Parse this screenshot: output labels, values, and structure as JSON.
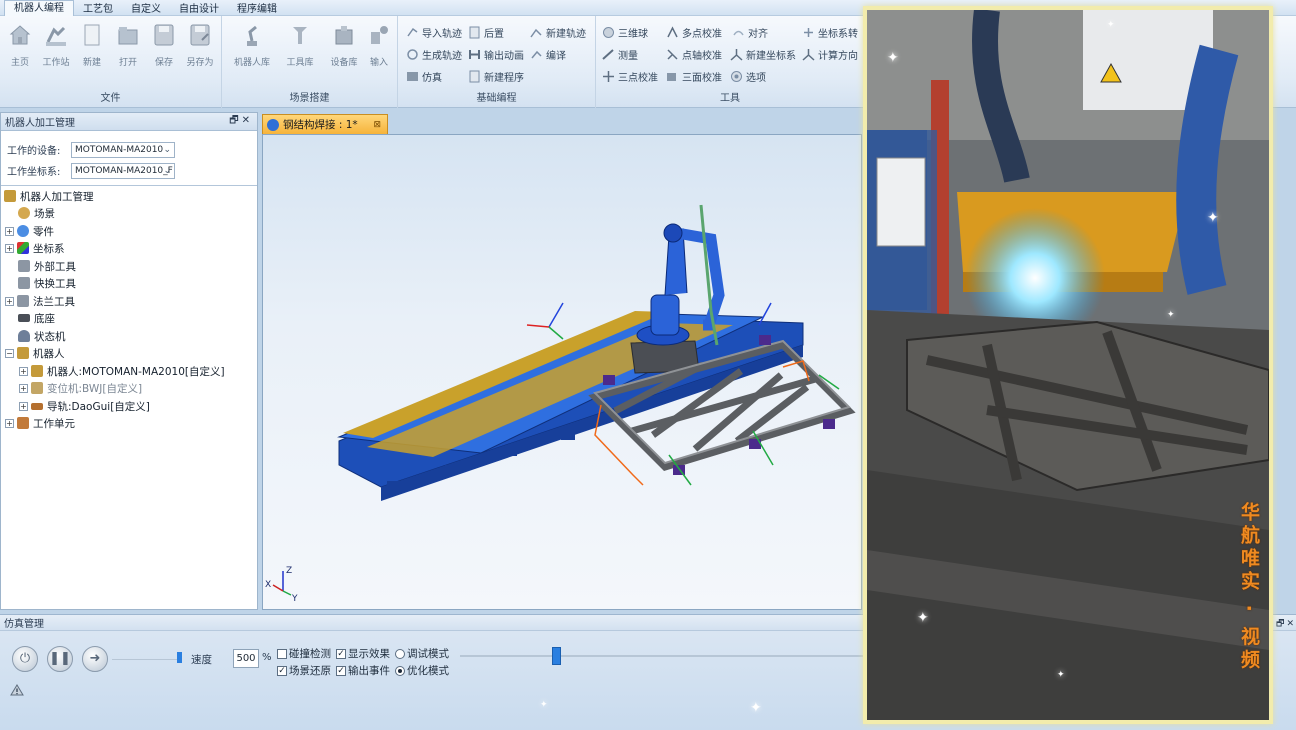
{
  "menu": {
    "items": [
      "机器人编程",
      "工艺包",
      "自定义",
      "自由设计",
      "程序编辑"
    ],
    "active_index": 0
  },
  "ribbon": {
    "groups": {
      "file": {
        "label": "文件",
        "buttons": [
          "主页",
          "工作站",
          "新建",
          "打开",
          "保存",
          "另存为"
        ]
      },
      "scene": {
        "label": "场景搭建",
        "buttons": [
          "机器人库",
          "工具库",
          "设备库",
          "输入"
        ]
      },
      "basic": {
        "label": "基础编程",
        "buttons": [
          "导入轨迹",
          "后置",
          "新建轨迹",
          "生成轨迹",
          "输出动画",
          "编译",
          "仿真",
          "新建程序"
        ]
      },
      "tools": {
        "label": "工具",
        "buttons": [
          "三维球",
          "多点校准",
          "对齐",
          "坐标系转",
          "测量",
          "点轴校准",
          "新建坐标系",
          "计算方向",
          "三点校准",
          "三面校准",
          "选项"
        ]
      }
    }
  },
  "left_panel": {
    "title": "机器人加工管理",
    "device_label": "工作的设备:",
    "device_value": "MOTOMAN-MA2010",
    "coord_label": "工作坐标系:",
    "coord_value": "MOTOMAN-MA2010_F",
    "tree": [
      {
        "label": "机器人加工管理"
      },
      {
        "label": "场景"
      },
      {
        "label": "零件"
      },
      {
        "label": "坐标系"
      },
      {
        "label": "外部工具"
      },
      {
        "label": "快换工具"
      },
      {
        "label": "法兰工具"
      },
      {
        "label": "底座"
      },
      {
        "label": "状态机"
      },
      {
        "label": "机器人"
      },
      {
        "label": "机器人:MOTOMAN-MA2010[自定义]"
      },
      {
        "label": "变位机:BWJ[自定义]"
      },
      {
        "label": "导轨:DaoGui[自定义]"
      },
      {
        "label": "工作单元"
      }
    ]
  },
  "document_tab": {
    "title": "钢结构焊接 : 1*",
    "close_glyph": "⊠"
  },
  "axis_triad": {
    "z": "Z",
    "x": "X",
    "y": "Y"
  },
  "simulation": {
    "title": "仿真管理",
    "speed_label": "速度",
    "speed_value": "500",
    "speed_unit": "%",
    "options": [
      {
        "label": "碰撞检测",
        "checked": false
      },
      {
        "label": "显示效果",
        "checked": true
      },
      {
        "label": "调试模式",
        "type": "radio",
        "checked": false
      },
      {
        "label": "场景还原",
        "checked": true
      },
      {
        "label": "输出事件",
        "checked": true
      },
      {
        "label": "优化模式",
        "type": "radio",
        "checked": true
      }
    ],
    "progress_fraction": 0.24
  },
  "video": {
    "watermark": "华航唯实 · 视频"
  },
  "colors": {
    "accent": "#2a7fe0",
    "tab_orange": "#f6b33b",
    "rail_blue": "#1f5fd1",
    "rail_gold": "#c9a12b",
    "frame_grey": "#6e7073",
    "border_frame": "#f2ecac"
  }
}
